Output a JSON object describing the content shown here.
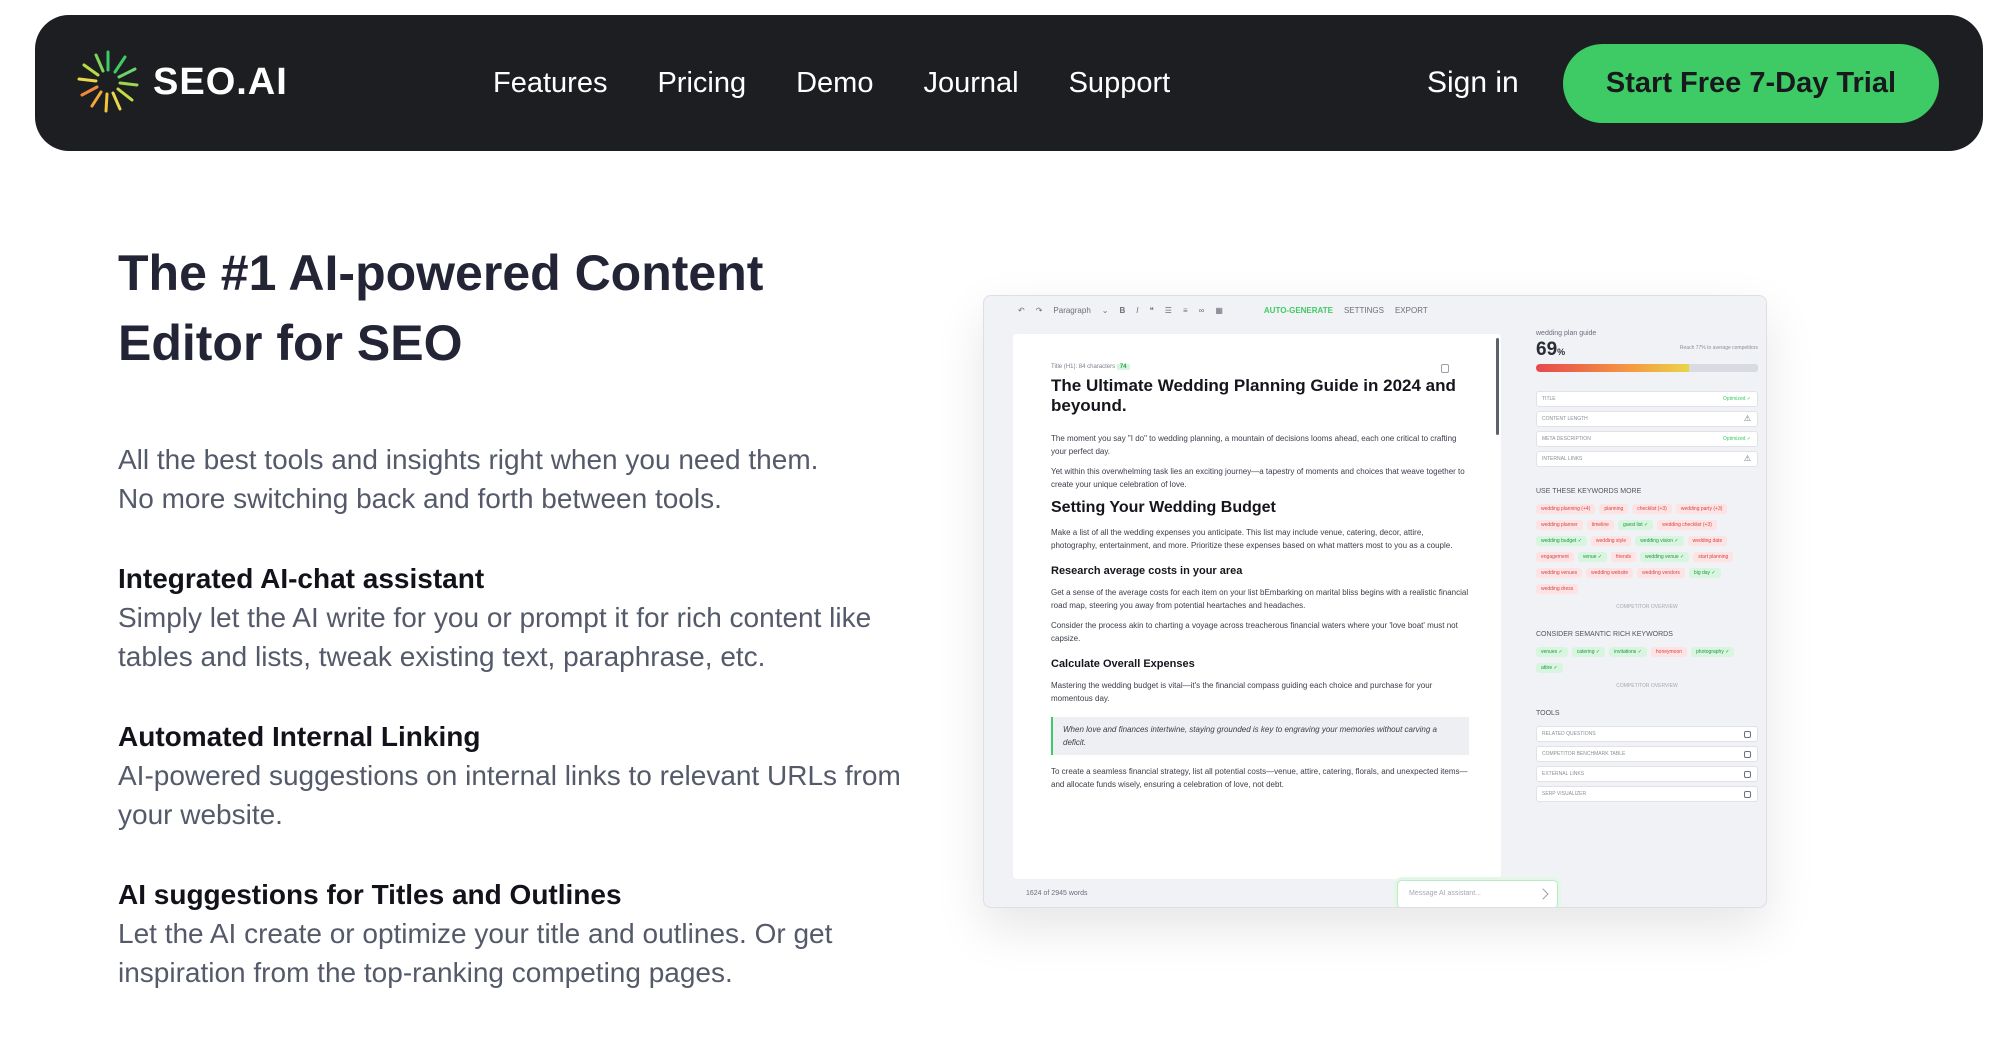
{
  "brand": {
    "name": "SEO.AI",
    "accent": "#3ecb65",
    "nav_bg": "#1d1e21"
  },
  "nav": {
    "links": [
      "Features",
      "Pricing",
      "Demo",
      "Journal",
      "Support"
    ],
    "signin": "Sign in",
    "cta": "Start Free 7-Day Trial"
  },
  "hero": {
    "title": "The #1 AI-powered Content Editor for SEO",
    "subtitle_line1": "All the best tools and insights right when you need them.",
    "subtitle_line2": "No more switching back and forth between tools."
  },
  "features": [
    {
      "title": "Integrated AI-chat assistant",
      "text": "Simply let the AI write for you or prompt it for rich content like tables and lists, tweak existing text, paraphrase, etc."
    },
    {
      "title": "Automated Internal Linking",
      "text": "AI-powered suggestions on internal links to relevant URLs from your website."
    },
    {
      "title": "AI suggestions for Titles and Outlines",
      "text": "Let the AI create or optimize your title and outlines. Or get inspiration from the top-ranking competing pages."
    }
  ],
  "editor": {
    "toolbar": {
      "paragraph": "Paragraph",
      "auto_generate": "AUTO-GENERATE",
      "settings": "SETTINGS",
      "export": "EXPORT"
    },
    "doc": {
      "meta_label": "Title (H1): 84 characters",
      "meta_badge": "74",
      "title": "The Ultimate Wedding Planning Guide in 2024 and beyound.",
      "p1": "The moment you say \"I do\" to wedding planning, a mountain of decisions looms ahead, each one critical to crafting your perfect day.",
      "p2": "Yet within this overwhelming task lies an exciting journey—a tapestry of moments and choices that weave together to create your unique celebration of love.",
      "h2": "Setting Your Wedding Budget",
      "p3": "Make a list of all the wedding expenses you anticipate. This list may include venue, catering, decor, attire, photography, entertainment, and more. Prioritize these expenses based on what matters most to you as a couple.",
      "h4a": "Research average costs in your area",
      "p4": "Get a sense of the average costs for each item on your list bEmbarking on marital bliss begins with a realistic financial road map, steering you away from potential heartaches and headaches.",
      "p5": "Consider the process akin to charting a voyage across treacherous financial waters where your 'love boat' must not capsize.",
      "h4b": "Calculate Overall Expenses",
      "p6": "Mastering the wedding budget is vital—it's the financial compass guiding each choice and purchase for your momentous day.",
      "quote": "When love and finances intertwine, staying grounded is key to engraving your memories without carving a deficit.",
      "p7": "To create a seamless financial strategy, list all potential costs—venue, attire, catering, florals, and unexpected items—and allocate funds wisely, ensuring a celebration of love, not debt."
    },
    "word_count": "1624 of 2945 words",
    "chat_placeholder": "Message AI assistant...",
    "sidebar": {
      "keyword": "wedding plan guide",
      "score": "69",
      "score_unit": "%",
      "score_note": "Reach 77% to average competitors",
      "score_value": 0.69,
      "checks": [
        {
          "label": "TITLE",
          "status": "Optimized ✓"
        },
        {
          "label": "CONTENT LENGTH",
          "status": "⚠"
        },
        {
          "label": "META DESCRIPTION",
          "status": "Optimized ✓"
        },
        {
          "label": "INTERNAL LINKS",
          "status": "⚠"
        }
      ],
      "keywords_title": "USE THESE KEYWORDS MORE",
      "keywords": [
        {
          "t": "wedding planning (+4)",
          "c": "r"
        },
        {
          "t": "planning",
          "c": "r"
        },
        {
          "t": "checklist (+3)",
          "c": "r"
        },
        {
          "t": "wedding party (+3)",
          "c": "r"
        },
        {
          "t": "wedding planner",
          "c": "r"
        },
        {
          "t": "timeline",
          "c": "r"
        },
        {
          "t": "guest list ✓",
          "c": "g"
        },
        {
          "t": "wedding checklist (+3)",
          "c": "r"
        },
        {
          "t": "wedding budget ✓",
          "c": "g"
        },
        {
          "t": "wedding style",
          "c": "r"
        },
        {
          "t": "wedding vision ✓",
          "c": "g"
        },
        {
          "t": "wedding date",
          "c": "r"
        },
        {
          "t": "engagement",
          "c": "r"
        },
        {
          "t": "venue ✓",
          "c": "g"
        },
        {
          "t": "friends",
          "c": "r"
        },
        {
          "t": "wedding venue ✓",
          "c": "g"
        },
        {
          "t": "start planning",
          "c": "r"
        },
        {
          "t": "wedding venues",
          "c": "r"
        },
        {
          "t": "wedding website",
          "c": "r"
        },
        {
          "t": "wedding vendors",
          "c": "r"
        },
        {
          "t": "big day ✓",
          "c": "g"
        },
        {
          "t": "wedding dress",
          "c": "r"
        }
      ],
      "competitor_overview": "COMPETITOR OVERVIEW",
      "semantic_title": "CONSIDER SEMANTIC RICH KEYWORDS",
      "semantic": [
        {
          "t": "venues ✓",
          "c": "g"
        },
        {
          "t": "catering ✓",
          "c": "g"
        },
        {
          "t": "invitations ✓",
          "c": "g"
        },
        {
          "t": "honeymoon",
          "c": "r"
        },
        {
          "t": "photography ✓",
          "c": "g"
        },
        {
          "t": "attire ✓",
          "c": "g"
        }
      ],
      "tools_title": "TOOLS",
      "tools": [
        "RELATED QUESTIONS",
        "COMPETITOR BENCHMARK TABLE",
        "EXTERNAL LINKS",
        "SERP VISUALIZER"
      ]
    }
  }
}
